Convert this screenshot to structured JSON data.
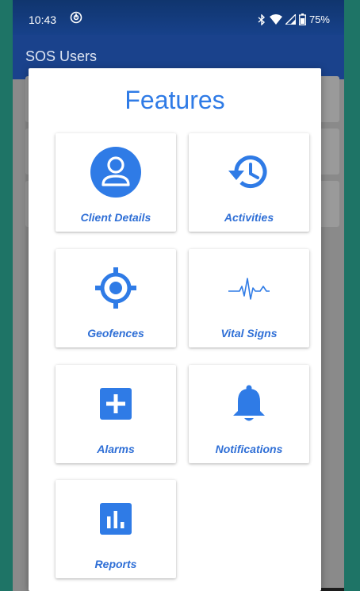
{
  "status_bar": {
    "time": "10:43",
    "battery": "75%",
    "icons": [
      "nfc-icon",
      "bluetooth-icon",
      "wifi-icon",
      "signal-icon",
      "battery-icon"
    ]
  },
  "app_bar": {
    "title": "SOS Users"
  },
  "dialog": {
    "title": "Features",
    "features": [
      {
        "label": "Client Details",
        "icon": "account-circle-icon"
      },
      {
        "label": "Activities",
        "icon": "history-clock-icon"
      },
      {
        "label": "Geofences",
        "icon": "target-location-icon"
      },
      {
        "label": "Vital Signs",
        "icon": "heartbeat-pulse-icon"
      },
      {
        "label": "Alarms",
        "icon": "plus-box-icon"
      },
      {
        "label": "Notifications",
        "icon": "bell-icon"
      },
      {
        "label": "Reports",
        "icon": "bar-chart-icon"
      }
    ]
  },
  "colors": {
    "accent": "#2f7be6",
    "app_bar": "#1a428c",
    "frame": "#1e7466"
  }
}
